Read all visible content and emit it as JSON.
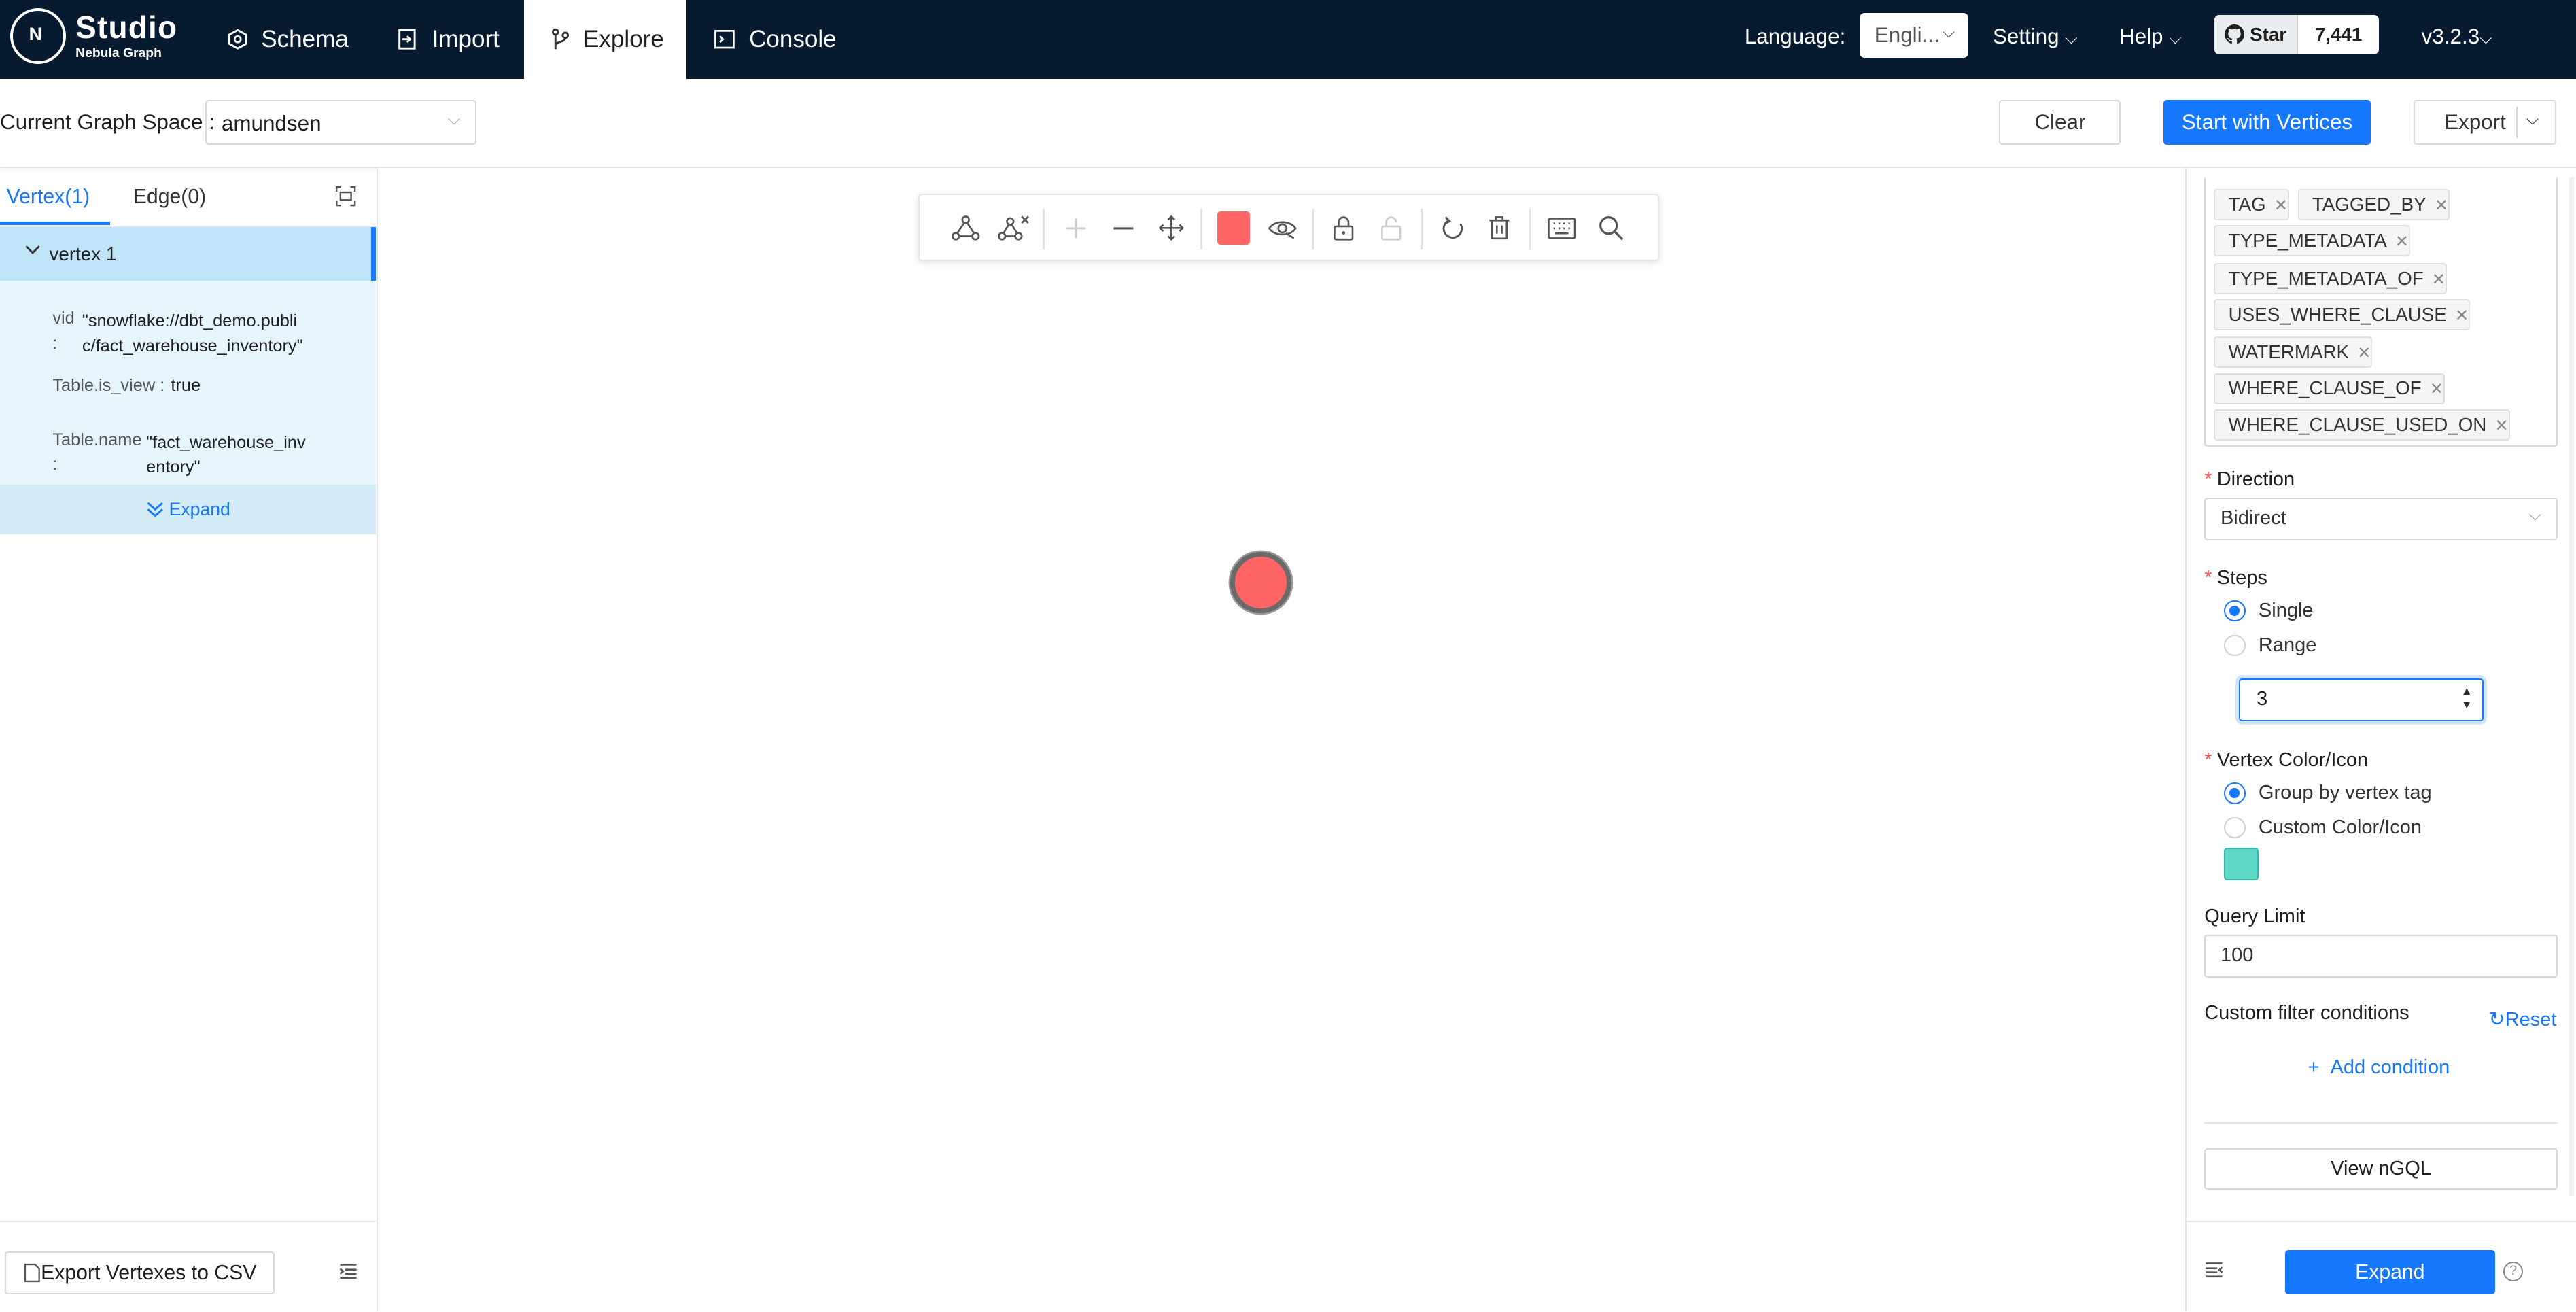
{
  "brand": {
    "name": "Studio",
    "sub": "Nebula Graph",
    "mark": "N"
  },
  "nav": {
    "items": [
      {
        "label": "Schema"
      },
      {
        "label": "Import"
      },
      {
        "label": "Explore"
      },
      {
        "label": "Console"
      }
    ],
    "active": "Explore",
    "language_label": "Language:",
    "language_value": "Engli...",
    "setting": "Setting",
    "help": "Help",
    "star_label": "Star",
    "star_count": "7,441",
    "version": "v3.2.3"
  },
  "subheader": {
    "space_label": "Current Graph Space :",
    "space_value": "amundsen",
    "clear": "Clear",
    "start": "Start with Vertices",
    "export": "Export"
  },
  "left": {
    "tab_vertex": "Vertex(1)",
    "tab_edge": "Edge(0)",
    "vertex_title": "vertex 1",
    "props": [
      {
        "key": "vid",
        "sep": ":",
        "value_l1": "\"snowflake://dbt_demo.publi",
        "value_l2": "c/fact_warehouse_inventory\""
      },
      {
        "key": "Table.is_view :",
        "value": "true"
      },
      {
        "key": "Table.name",
        "sep": ":",
        "value_l1": "\"fact_warehouse_inv",
        "value_l2": "entory\""
      }
    ],
    "expand": "Expand",
    "export_csv": "Export Vertexes to CSV"
  },
  "toolbar": {
    "icons": [
      "add-edge-icon",
      "delete-edge-icon",
      "zoom-in-icon",
      "zoom-out-icon",
      "fit-view-icon",
      "node-color-icon",
      "hide-icon",
      "lock-icon",
      "unlock-icon",
      "undo-icon",
      "delete-icon",
      "keyboard-icon",
      "search-icon"
    ],
    "node_color": "#ff6565"
  },
  "right": {
    "edge_types": [
      "TAG",
      "TAGGED_BY",
      "TYPE_METADATA",
      "TYPE_METADATA_OF",
      "USES_WHERE_CLAUSE",
      "WATERMARK",
      "WHERE_CLAUSE_OF",
      "WHERE_CLAUSE_USED_ON"
    ],
    "direction_label": "Direction",
    "direction_value": "Bidirect",
    "steps_label": "Steps",
    "steps_single": "Single",
    "steps_range": "Range",
    "steps_value": "3",
    "color_label": "Vertex Color/Icon",
    "color_group": "Group by vertex tag",
    "color_custom": "Custom Color/Icon",
    "swatch_color": "#5ed8c7",
    "limit_label": "Query Limit",
    "limit_value": "100",
    "filter_label": "Custom filter conditions",
    "reset": "Reset",
    "add_condition": "Add condition",
    "view_ngql": "View nGQL",
    "expand": "Expand"
  },
  "colors": {
    "nav_bg": "#071a2f",
    "accent": "#1677ff",
    "vertex_header": "#bfe3f7"
  }
}
